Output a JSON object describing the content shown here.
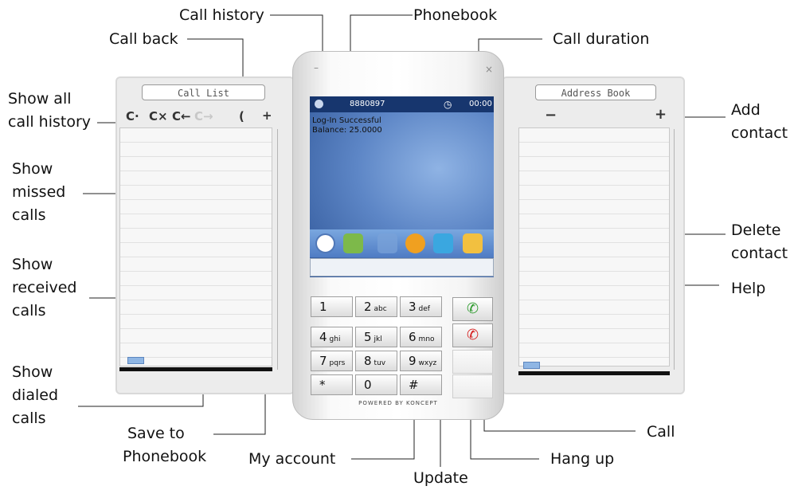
{
  "annotations": {
    "call_history": "Call history",
    "phonebook": "Phonebook",
    "call_back": "Call back",
    "call_duration": "Call duration",
    "show_all_call_history": [
      "Show  all",
      "call history"
    ],
    "add_contact": [
      "Add",
      "contact"
    ],
    "show_missed_calls": [
      "Show",
      "missed",
      "calls"
    ],
    "show_received_calls": [
      "Show",
      "received",
      "calls"
    ],
    "delete_contact": [
      "Delete",
      "contact"
    ],
    "help": "Help",
    "show_dialed_calls": [
      "Show",
      "dialed",
      "calls"
    ],
    "save_to_phonebook": [
      "Save  to",
      "Phonebook"
    ],
    "my_account": "My account",
    "call": "Call",
    "hang_up": "Hang up",
    "update": "Update"
  },
  "call_list": {
    "title": "Call List",
    "toolbar": [
      {
        "icon": "show-all-calls-icon",
        "glyph": "C·"
      },
      {
        "icon": "missed-calls-icon",
        "glyph": "C×"
      },
      {
        "icon": "received-calls-icon",
        "glyph": "C←"
      },
      {
        "icon": "dialed-calls-icon",
        "glyph": "C→"
      },
      {
        "icon": "call-back-icon",
        "glyph": "("
      },
      {
        "icon": "save-to-phonebook-icon",
        "glyph": "+"
      }
    ]
  },
  "address_book": {
    "title": "Address Book",
    "delete_glyph": "−",
    "add_glyph": "+"
  },
  "phone": {
    "minimize_glyph": "–",
    "close_glyph": "×",
    "number": "8880897",
    "duration": "00:00",
    "status_line1": "Log-In Successful",
    "status_line2": "Balance: 25.0000",
    "powered_by": "POWERED BY KONCEPT",
    "dock": [
      {
        "icon": "call-history-icon",
        "color": "#ffffff"
      },
      {
        "icon": "phonebook-icon",
        "color": "#7db94a"
      },
      {
        "icon": "my-account-icon",
        "color": "#7aa3d8"
      },
      {
        "icon": "my-account-tool-icon",
        "color": "#f0a020"
      },
      {
        "icon": "update-icon",
        "color": "#3aa7e0"
      },
      {
        "icon": "help-icon",
        "color": "#f2c040"
      }
    ],
    "keypad": [
      {
        "digit": "1",
        "letters": ""
      },
      {
        "digit": "2",
        "letters": "abc"
      },
      {
        "digit": "3",
        "letters": "def"
      },
      {
        "digit": "4",
        "letters": "ghi"
      },
      {
        "digit": "5",
        "letters": "jkl"
      },
      {
        "digit": "6",
        "letters": "mno"
      },
      {
        "digit": "7",
        "letters": "pqrs"
      },
      {
        "digit": "8",
        "letters": "tuv"
      },
      {
        "digit": "9",
        "letters": "wxyz"
      },
      {
        "digit": "*",
        "letters": ""
      },
      {
        "digit": "0",
        "letters": ""
      },
      {
        "digit": "#",
        "letters": ""
      }
    ],
    "call_glyph": "✆",
    "hangup_glyph": "✆",
    "colors": {
      "call": "#2e9b2e",
      "hangup": "#d62020",
      "screen_bar": "#17366e"
    }
  }
}
